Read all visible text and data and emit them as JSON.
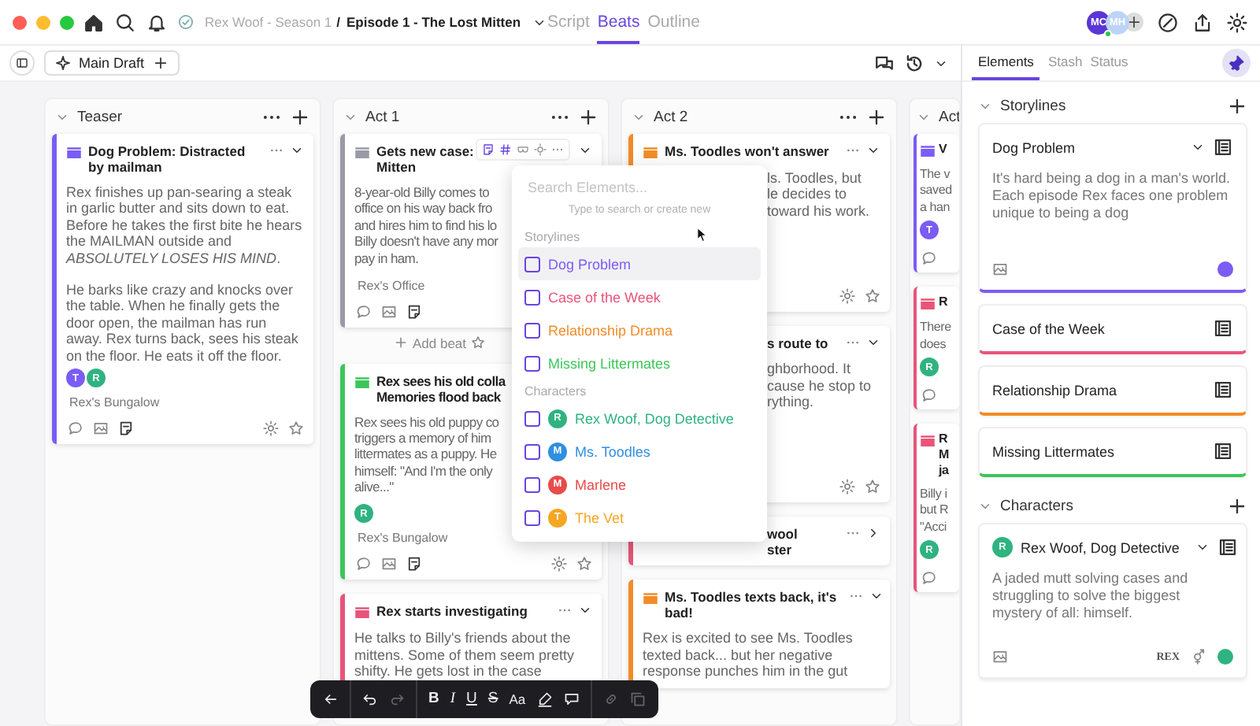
{
  "breadcrumb": {
    "project": "Rex Woof - Season 1",
    "separator": "/",
    "episode": "Episode 1 - The Lost Mitten"
  },
  "view_tabs": [
    {
      "label": "Script",
      "selected": false
    },
    {
      "label": "Beats",
      "selected": true
    },
    {
      "label": "Outline",
      "selected": false
    }
  ],
  "collaborators": [
    {
      "initials": "MC",
      "color": "#5a36d6",
      "online": false
    },
    {
      "initials": "MH",
      "color": "#bcd4f6",
      "online": true
    }
  ],
  "draft": {
    "label": "Main Draft"
  },
  "panel_tabs": [
    {
      "label": "Elements",
      "selected": true
    },
    {
      "label": "Stash",
      "selected": false
    },
    {
      "label": "Status",
      "selected": false
    }
  ],
  "columns": [
    {
      "name": "Teaser",
      "kind": "plain",
      "items": [
        {
          "kind": "card",
          "title": [
            "Dog Problem: Distracted",
            "by mailman"
          ],
          "color": "#7b5cf5",
          "menu": true,
          "expanded": true,
          "tools": true,
          "hover_tools": false,
          "title_covered": false,
          "body_covered": false,
          "body": [
            "Rex finishes up pan-searing a steak in garlic butter and sits down to eat. Before he takes the first bite he hears the MAILMAN outside and *ABSOLUTELY LOSES HIS MIND*.",
            "He barks like crazy and knocks over the table. When he finally gets the door open, the mailman has run away. Rex turns back, sees his steak on the floor.  He eats it off the floor."
          ],
          "avatars": [
            {
              "initial": "T",
              "color": "#7b5cf5"
            },
            {
              "initial": "R",
              "color": "#2fb380"
            }
          ],
          "location": "Rex's Bungalow"
        }
      ]
    },
    {
      "name": "Act 1",
      "kind": "covered-right",
      "items": [
        {
          "kind": "card",
          "title": [
            "Gets new case:",
            "Mitten"
          ],
          "color": "#9a9aa6",
          "menu": false,
          "expanded": true,
          "tools": false,
          "hover_tools": true,
          "title_covered": false,
          "body_covered": true,
          "body": [
            "8-year-old Billy comes to",
            "office on his way back fro",
            "and hires him to find his lo",
            "Billy doesn't have any mor",
            "pay in ham."
          ],
          "location": "Rex's Office"
        },
        {
          "kind": "add-beat",
          "label": "Add beat"
        },
        {
          "kind": "card",
          "title": [
            "Rex sees his old colla",
            "Memories flood back"
          ],
          "color": "#3cc65a",
          "menu": false,
          "tools": true,
          "hover_tools": false,
          "title_covered": true,
          "body_covered": true,
          "body": [
            "Rex sees his old puppy co",
            "triggers a memory of him",
            "littermates as a puppy. He",
            "himself: \"And I'm the only",
            "alive...\""
          ],
          "avatars": [
            {
              "initial": "R",
              "color": "#2fb380"
            }
          ],
          "location": "Rex's Bungalow"
        },
        {
          "kind": "card",
          "title": [
            "Rex starts investigating"
          ],
          "color": "#e8547a",
          "menu": true,
          "expanded": true,
          "tools": false,
          "hover_tools": false,
          "title_covered": false,
          "body_covered": false,
          "body": [
            "He talks to Billy's friends about the mittens. Some of them seem pretty shifty. He gets lost in the case"
          ]
        }
      ]
    },
    {
      "name": "Act 2",
      "kind": "covered-left",
      "items": [
        {
          "kind": "card",
          "title": [
            "Ms. Toodles won't answer"
          ],
          "color": "#f28c28",
          "menu": true,
          "expanded": true,
          "tools": true,
          "hover_tools": false,
          "title_covered": false,
          "body_covered": true,
          "body": [
            "ls. Toodles, but",
            "le decides to",
            "toward his work."
          ]
        },
        {
          "kind": "card",
          "title": [
            "s route to"
          ],
          "menu": true,
          "expanded": true,
          "tools": true,
          "hover_tools": false,
          "title_covered": true,
          "body_covered": true,
          "body": [
            "ghborhood. It",
            "cause he stop to",
            "rything."
          ]
        },
        {
          "kind": "card",
          "title": [
            "wool",
            "ster"
          ],
          "color": "#e8547a",
          "menu": true,
          "expanded": false,
          "tools": false,
          "hover_tools": false,
          "title_covered": true,
          "body_covered": false
        },
        {
          "kind": "card",
          "title": [
            "Ms. Toodles texts back, it's",
            "bad!"
          ],
          "color": "#f28c28",
          "menu": true,
          "expanded": true,
          "tools": false,
          "hover_tools": false,
          "title_covered": false,
          "body_covered": false,
          "body": [
            "Rex is excited to see Ms. Toodles texted back... but her negative response punches him in the gut"
          ]
        }
      ]
    },
    {
      "name": "Act",
      "kind": "cut-off",
      "items": [
        {
          "kind": "card",
          "title": [
            "V"
          ],
          "color": "#7b5cf5",
          "menu": false,
          "tools": false,
          "hover_tools": false,
          "title_covered": false,
          "body": [
            "The v",
            "saved",
            "a han"
          ],
          "avatars": [
            {
              "initial": "T",
              "color": "#7b5cf5"
            }
          ]
        },
        {
          "kind": "card",
          "title": [
            "R"
          ],
          "color": "#e8547a",
          "menu": false,
          "tools": false,
          "hover_tools": false,
          "title_covered": false,
          "body": [
            "There",
            "does"
          ],
          "avatars": [
            {
              "initial": "R",
              "color": "#2fb380"
            }
          ]
        },
        {
          "kind": "card",
          "title": [
            "R",
            "M",
            "ja"
          ],
          "color": "#e8547a",
          "menu": false,
          "tools": false,
          "hover_tools": false,
          "title_covered": false,
          "body": [
            "Billy i",
            "but R",
            "\"Acci"
          ],
          "avatars": [
            {
              "initial": "R",
              "color": "#2fb380"
            }
          ]
        }
      ]
    }
  ],
  "element_picker": {
    "placeholder": "Search Elements...",
    "hint": "Type to search or create new",
    "sections": [
      {
        "title": "Storylines",
        "items": [
          {
            "label": "Dog Problem",
            "color": "#7b5cf5",
            "checked": false,
            "selected": true
          },
          {
            "label": "Case of the Week",
            "color": "#e8547a",
            "checked": false,
            "selected": false
          },
          {
            "label": "Relationship Drama",
            "color": "#f28c28",
            "checked": false,
            "selected": false
          },
          {
            "label": "Missing Littermates",
            "color": "#3cc65a",
            "checked": false,
            "selected": false
          }
        ]
      },
      {
        "title": "Characters",
        "items": [
          {
            "label": "Rex Woof, Dog Detective",
            "initial": "R",
            "color": "#2fb380",
            "checked": false,
            "selected": false
          },
          {
            "label": "Ms. Toodles",
            "initial": "M",
            "color": "#2f8fe0",
            "checked": false,
            "selected": false
          },
          {
            "label": "Marlene",
            "initial": "M",
            "color": "#e84b4b",
            "checked": false,
            "selected": false
          },
          {
            "label": "The Vet",
            "initial": "T",
            "color": "#f5a623",
            "checked": false,
            "selected": false
          }
        ]
      }
    ]
  },
  "storylines": {
    "title": "Storylines",
    "items": [
      {
        "name": "Dog Problem",
        "color": "#7b5cf5",
        "expanded": true,
        "description": "It's hard being a dog in a man's world. Each episode Rex faces one problem unique to being a dog"
      },
      {
        "name": "Case of the Week",
        "color": "#e8547a",
        "expanded": false
      },
      {
        "name": "Relationship Drama",
        "color": "#f28c28",
        "expanded": false
      },
      {
        "name": "Missing Littermates",
        "color": "#3cc65a",
        "expanded": false
      }
    ]
  },
  "characters": {
    "title": "Characters",
    "items": [
      {
        "name": "Rex Woof, Dog Detective",
        "initial": "R",
        "color": "#2fb380",
        "expanded": true,
        "description": "A jaded mutt solving cases and struggling to solve the biggest mystery of all: himself.",
        "tag": "REX"
      }
    ]
  },
  "toolbar": [
    {
      "kind": "back",
      "disabled": false
    },
    {
      "kind": "undo",
      "disabled": false
    },
    {
      "kind": "redo",
      "disabled": true
    },
    {
      "kind": "bold",
      "label": "B",
      "disabled": false
    },
    {
      "kind": "italic",
      "label": "I",
      "disabled": false
    },
    {
      "kind": "underline",
      "label": "U",
      "disabled": false
    },
    {
      "kind": "strike",
      "label": "S",
      "disabled": false
    },
    {
      "kind": "case",
      "label": "Aa",
      "disabled": false
    },
    {
      "kind": "highlight",
      "disabled": false
    },
    {
      "kind": "comment",
      "disabled": false
    },
    {
      "kind": "link",
      "disabled": true
    },
    {
      "kind": "duplicate",
      "disabled": true
    }
  ]
}
